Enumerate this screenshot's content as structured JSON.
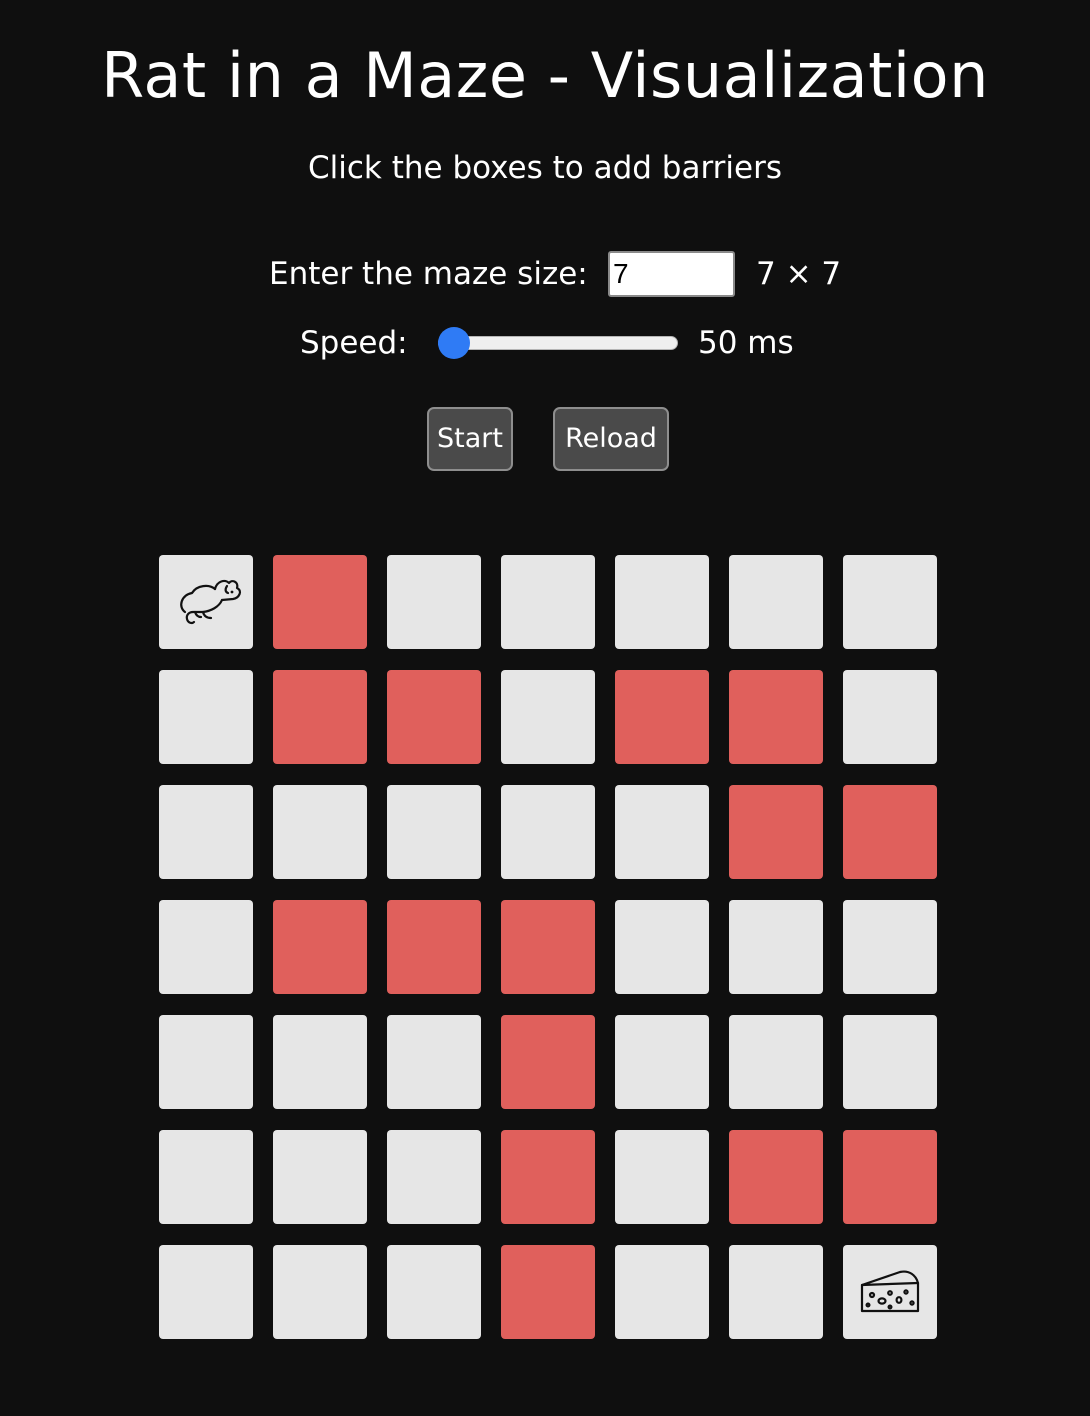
{
  "header": {
    "title": "Rat in a Maze - Visualization",
    "subtitle": "Click the boxes to add barriers"
  },
  "controls": {
    "size_label": "Enter the maze size:",
    "size_value": "7",
    "size_display": "7 × 7",
    "speed_label": "Speed:",
    "speed_fraction": 0.0,
    "speed_value": "50 ms",
    "start_label": "Start",
    "reload_label": "Reload"
  },
  "colors": {
    "background": "#0f0f0f",
    "cell_open": "#e6e6e6",
    "cell_barrier": "#e0605c",
    "slider_accent": "#2f7bf5",
    "button_bg": "#4a4a4a"
  },
  "maze": {
    "size": 7,
    "start_icon": "rat-icon",
    "goal_icon": "cheese-icon",
    "cells": [
      [
        "rat",
        "barrier",
        "open",
        "open",
        "open",
        "open",
        "open"
      ],
      [
        "open",
        "barrier",
        "barrier",
        "open",
        "barrier",
        "barrier",
        "open"
      ],
      [
        "open",
        "open",
        "open",
        "open",
        "open",
        "barrier",
        "barrier"
      ],
      [
        "open",
        "barrier",
        "barrier",
        "barrier",
        "open",
        "open",
        "open"
      ],
      [
        "open",
        "open",
        "open",
        "barrier",
        "open",
        "open",
        "open"
      ],
      [
        "open",
        "open",
        "open",
        "barrier",
        "open",
        "barrier",
        "barrier"
      ],
      [
        "open",
        "open",
        "open",
        "barrier",
        "open",
        "open",
        "cheese"
      ]
    ]
  }
}
